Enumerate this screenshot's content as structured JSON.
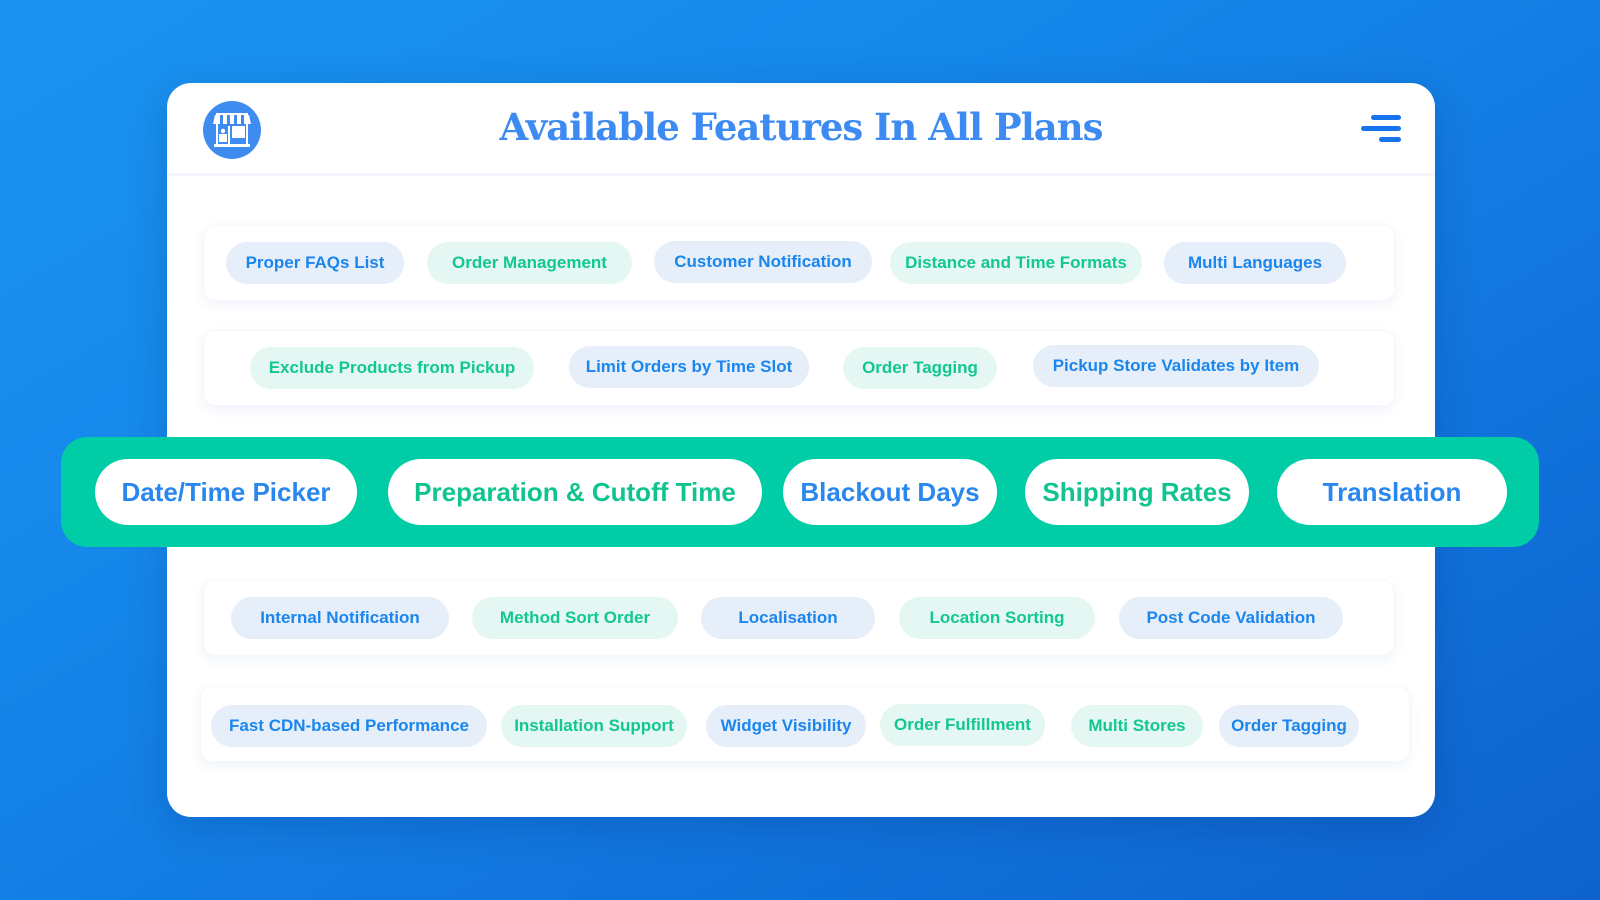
{
  "header": {
    "title": "Available Features In All Plans",
    "logo_icon": "storefront-icon",
    "menu_icon": "menu-icon"
  },
  "colors": {
    "accent_blue": "#3d8af2",
    "pill_blue_text": "#1a86ee",
    "pill_blue_bg": "#e6eef9",
    "pill_green_text": "#12c792",
    "pill_green_bg": "#e4f7f2",
    "highlight_band": "#00cca6"
  },
  "rows": [
    {
      "features": [
        {
          "label": "Proper FAQs List",
          "color": "blue"
        },
        {
          "label": "Order Management",
          "color": "green"
        },
        {
          "label": "Customer Notification",
          "color": "blue"
        },
        {
          "label": "Distance and Time Formats",
          "color": "green"
        },
        {
          "label": "Multi Languages",
          "color": "blue"
        }
      ]
    },
    {
      "features": [
        {
          "label": "Exclude Products from Pickup",
          "color": "green"
        },
        {
          "label": "Limit Orders by Time Slot",
          "color": "blue"
        },
        {
          "label": "Order Tagging",
          "color": "green"
        },
        {
          "label": "Pickup Store Validates by Item",
          "color": "blue"
        }
      ]
    },
    {
      "features": [
        {
          "label": "Internal Notification",
          "color": "blue"
        },
        {
          "label": "Method Sort Order",
          "color": "green"
        },
        {
          "label": "Localisation",
          "color": "blue"
        },
        {
          "label": "Location Sorting",
          "color": "green"
        },
        {
          "label": "Post Code Validation",
          "color": "blue"
        }
      ]
    },
    {
      "features": [
        {
          "label": "Fast CDN-based Performance",
          "color": "blue"
        },
        {
          "label": "Installation Support",
          "color": "green"
        },
        {
          "label": "Widget Visibility",
          "color": "blue"
        },
        {
          "label": "Order Fulfillment",
          "color": "green"
        },
        {
          "label": "Multi Stores",
          "color": "green"
        },
        {
          "label": "Order Tagging",
          "color": "blue"
        }
      ]
    }
  ],
  "highlighted": [
    {
      "label": "Date/Time Picker",
      "color": "blue"
    },
    {
      "label": "Preparation & Cutoff Time",
      "color": "green"
    },
    {
      "label": "Blackout Days",
      "color": "blue"
    },
    {
      "label": "Shipping Rates",
      "color": "green"
    },
    {
      "label": "Translation",
      "color": "blue"
    }
  ]
}
